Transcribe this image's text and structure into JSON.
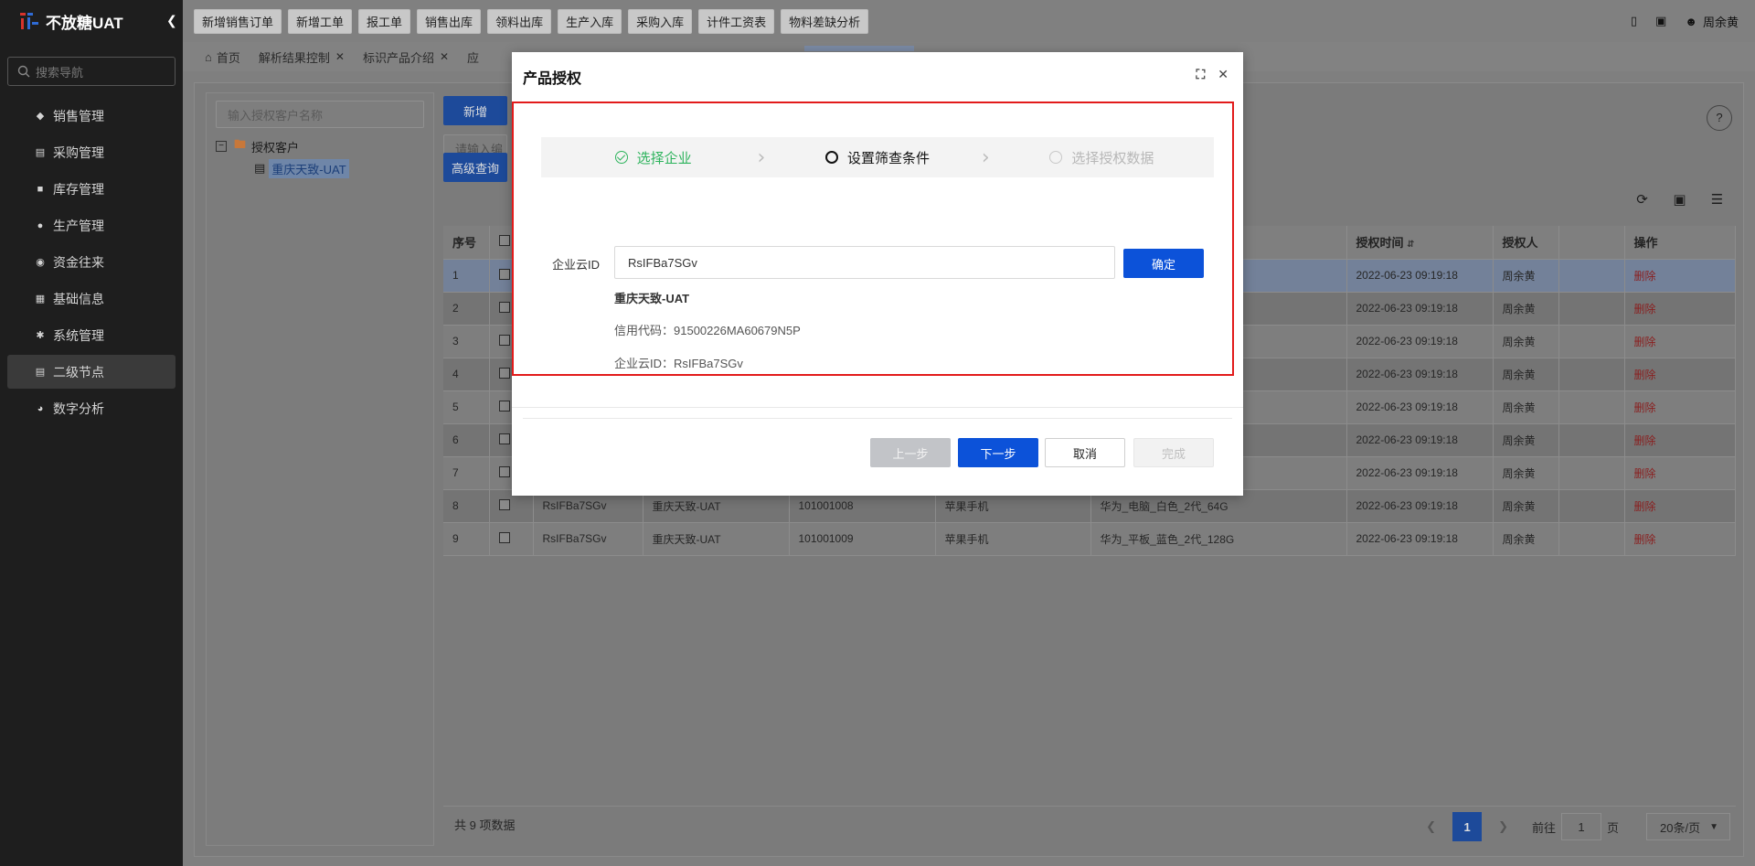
{
  "app": {
    "title": "不放糖UAT",
    "collapse_icon": "chevron-left"
  },
  "sidebar": {
    "search_placeholder": "搜索导航",
    "items": [
      {
        "label": "销售管理",
        "icon": "tag"
      },
      {
        "label": "采购管理",
        "icon": "cart"
      },
      {
        "label": "库存管理",
        "icon": "box"
      },
      {
        "label": "生产管理",
        "icon": "factory"
      },
      {
        "label": "资金往来",
        "icon": "money"
      },
      {
        "label": "基础信息",
        "icon": "grid"
      },
      {
        "label": "系统管理",
        "icon": "gear"
      },
      {
        "label": "二级节点",
        "icon": "doc"
      },
      {
        "label": "数字分析",
        "icon": "pie"
      }
    ]
  },
  "topbar": {
    "buttons": [
      "新增销售订单",
      "新增工单",
      "报工单",
      "销售出库",
      "领料出库",
      "生产入库",
      "采购入库",
      "计件工资表",
      "物料差缺分析"
    ],
    "user": "周余黄"
  },
  "tabs": [
    {
      "label": "首页"
    },
    {
      "label": "解析结果控制"
    },
    {
      "label": "标识产品介绍"
    },
    {
      "label": "应"
    }
  ],
  "tree": {
    "search_placeholder": "输入授权客户名称",
    "root": "授权客户",
    "child": "重庆天致-UAT"
  },
  "main": {
    "add_button": "新增",
    "filter_placeholder": "请输入编",
    "advanced_query": "高级查询"
  },
  "table": {
    "headers": [
      "序号",
      "",
      "",
      "",
      "",
      "",
      "",
      "授权时间",
      "授权人",
      "",
      "操作"
    ],
    "rows": [
      {
        "idx": "1",
        "c1": "",
        "c2": "",
        "c3": "",
        "c4": "",
        "c5": "",
        "time": "2022-06-23 09:19:18",
        "user": "周余黄",
        "op": "删除"
      },
      {
        "idx": "2",
        "c1": "",
        "c2": "",
        "c3": "",
        "c4": "",
        "c5": "",
        "time": "2022-06-23 09:19:18",
        "user": "周余黄",
        "op": "删除"
      },
      {
        "idx": "3",
        "c1": "",
        "c2": "",
        "c3": "",
        "c4": "",
        "c5": "",
        "time": "2022-06-23 09:19:18",
        "user": "周余黄",
        "op": "删除"
      },
      {
        "idx": "4",
        "c1": "",
        "c2": "",
        "c3": "",
        "c4": "",
        "c5": "",
        "time": "2022-06-23 09:19:18",
        "user": "周余黄",
        "op": "删除"
      },
      {
        "idx": "5",
        "c1": "",
        "c2": "",
        "c3": "",
        "c4": "",
        "c5": "",
        "time": "2022-06-23 09:19:18",
        "user": "周余黄",
        "op": "删除"
      },
      {
        "idx": "6",
        "c1": "",
        "c2": "",
        "c3": "",
        "c4": "",
        "c5": "",
        "time": "2022-06-23 09:19:18",
        "user": "周余黄",
        "op": "删除"
      },
      {
        "idx": "7",
        "c1": "",
        "c2": "",
        "c3": "",
        "c4": "",
        "c5": "",
        "time": "2022-06-23 09:19:18",
        "user": "周余黄",
        "op": "删除"
      },
      {
        "idx": "8",
        "c1": "RsIFBa7SGv",
        "c2": "重庆天致-UAT",
        "c3": "101001008",
        "c4": "苹果手机",
        "c5": "华为_电脑_白色_2代_64G",
        "time": "2022-06-23 09:19:18",
        "user": "周余黄",
        "op": "删除"
      },
      {
        "idx": "9",
        "c1": "RsIFBa7SGv",
        "c2": "重庆天致-UAT",
        "c3": "101001009",
        "c4": "苹果手机",
        "c5": "华为_平板_蓝色_2代_128G",
        "time": "2022-06-23 09:19:18",
        "user": "周余黄",
        "op": "删除"
      }
    ]
  },
  "pager": {
    "total": "共 9 项数据",
    "current": "1",
    "goto_label": "前往",
    "goto_value": "1",
    "page_unit": "页",
    "size": "20条/页"
  },
  "modal": {
    "title": "产品授权",
    "steps": [
      {
        "label": "选择企业",
        "state": "done"
      },
      {
        "label": "设置筛查条件",
        "state": "current"
      },
      {
        "label": "选择授权数据",
        "state": "pending"
      }
    ],
    "field_label": "企业云ID",
    "field_value": "RsIFBa7SGv",
    "confirm": "确定",
    "company_name": "重庆天致-UAT",
    "credit_code": "信用代码：91500226MA60679N5P",
    "cloud_id": "企业云ID：RsIFBa7SGv",
    "prev": "上一步",
    "next": "下一步",
    "cancel": "取消",
    "finish": "完成",
    "highlight_color": "#e21b1b",
    "primary_color": "#0c52d9",
    "done_color": "#2db35c"
  }
}
